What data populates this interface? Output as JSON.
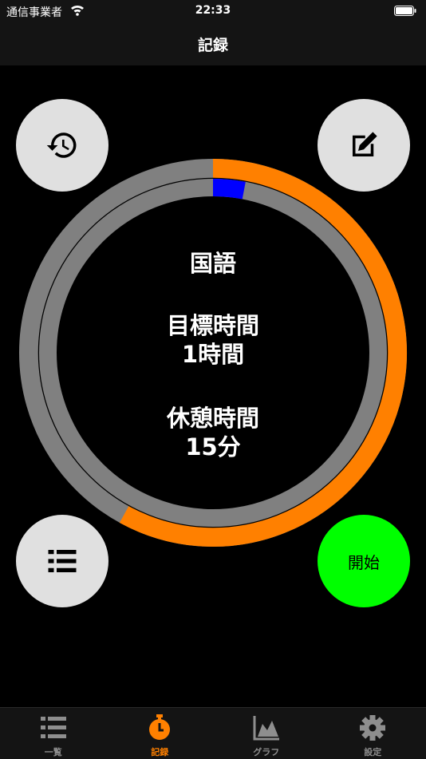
{
  "status_bar": {
    "carrier": "通信事業者",
    "time": "22:33"
  },
  "nav": {
    "title": "記録"
  },
  "timer": {
    "subject": "国語",
    "goal_label": "目標時間",
    "goal_value": "1時間",
    "break_label": "休憩時間",
    "break_value": "15分",
    "outer_progress": 0.58,
    "inner_progress": 0.03
  },
  "buttons": {
    "start_label": "開始"
  },
  "tabs": [
    {
      "label": "一覧",
      "icon": "list-icon"
    },
    {
      "label": "記録",
      "icon": "stopwatch-icon"
    },
    {
      "label": "グラフ",
      "icon": "chart-icon"
    },
    {
      "label": "設定",
      "icon": "gear-icon"
    }
  ],
  "colors": {
    "outer_ring": "#ff8000",
    "inner_ring": "#0000ff",
    "track": "#808080",
    "start_button": "#00ff00",
    "active_tab": "#ff8000"
  }
}
